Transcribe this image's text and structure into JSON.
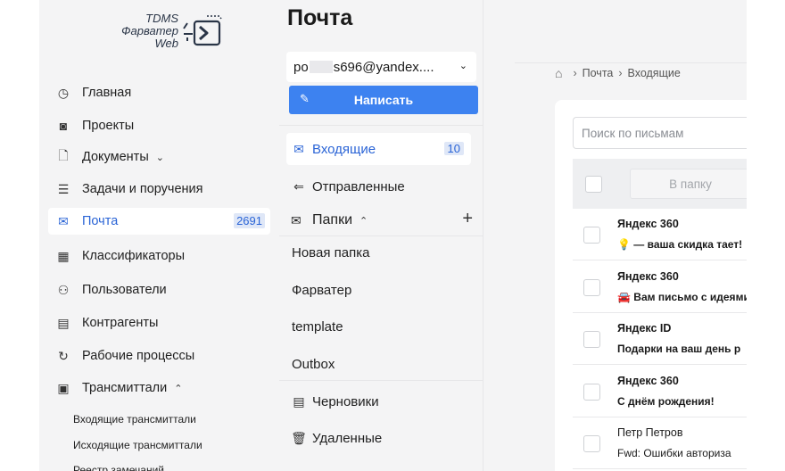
{
  "logo": {
    "line1": "TDMS",
    "line2": "Фарватер",
    "line3": "Web"
  },
  "nav": [
    {
      "label": "Главная",
      "icon": "clock-icon",
      "glyph": "◷"
    },
    {
      "label": "Проекты",
      "icon": "projects-icon",
      "glyph": "◙"
    },
    {
      "label": "Документы",
      "icon": "document-icon",
      "glyph": "🗋",
      "chevron": "⌄"
    },
    {
      "label": "Задачи и поручения",
      "icon": "tasks-icon",
      "glyph": "☰"
    },
    {
      "label": "Почта",
      "icon": "mail-icon",
      "glyph": "✉",
      "count": "2691",
      "active": true
    },
    {
      "label": "Классификаторы",
      "icon": "grid-icon",
      "glyph": "▦"
    },
    {
      "label": "Пользователи",
      "icon": "users-icon",
      "glyph": "⚇"
    },
    {
      "label": "Контрагенты",
      "icon": "contacts-icon",
      "glyph": "▤"
    },
    {
      "label": "Рабочие процессы",
      "icon": "workflow-icon",
      "glyph": "↻"
    },
    {
      "label": "Трансмиттали",
      "icon": "transmittal-icon",
      "glyph": "▣",
      "chevron": "⌃"
    }
  ],
  "nav_sub": [
    "Входящие трансмиттали",
    "Исходящие трансмиттали",
    "Реестр замечаний"
  ],
  "mail_page": {
    "title": "Почта",
    "account_prefix": "po",
    "account_suffix": "s696@yandex....",
    "compose_label": "Написать",
    "folders_top": [
      {
        "label": "Входящие",
        "icon": "inbox-icon",
        "glyph": "✉",
        "count": "10",
        "active": true
      },
      {
        "label": "Отправленные",
        "icon": "sent-icon",
        "glyph": "⇐"
      }
    ],
    "folders_header": {
      "label": "Папки",
      "chevron": "⌃",
      "add": "+"
    },
    "user_folders": [
      "Новая папка",
      "Фарватер",
      "template",
      "Outbox"
    ],
    "folders_bottom": [
      {
        "label": "Черновики",
        "icon": "drafts-icon",
        "glyph": "▤"
      },
      {
        "label": "Удаленные",
        "icon": "trash-icon",
        "glyph": "🗑"
      }
    ]
  },
  "breadcrumb": {
    "home": "⌂",
    "items": [
      "Почта",
      "Входящие"
    ],
    "separator": "›"
  },
  "search": {
    "placeholder": "Поиск по письмам"
  },
  "toolbar": {
    "to_folder": "В папку"
  },
  "messages": [
    {
      "from": "Яндекс 360",
      "subject": "💡 — ваша скидка тает!",
      "unread": true
    },
    {
      "from": "Яндекс 360",
      "subject": "🚘 Вам письмо с идеями",
      "unread": true
    },
    {
      "from": "Яндекс ID",
      "subject": "Подарки на ваш день р",
      "unread": true
    },
    {
      "from": "Яндекс 360",
      "subject": "С днём рождения!",
      "unread": true
    },
    {
      "from": "Петр Петров",
      "subject": "Fwd: Ошибки авториза",
      "unread": false
    }
  ]
}
